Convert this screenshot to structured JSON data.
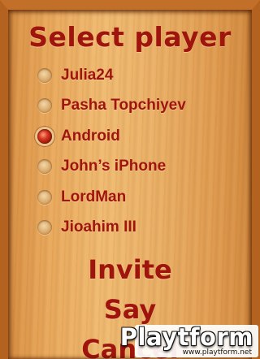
{
  "title": "Select player",
  "players": [
    {
      "name": "Julia24",
      "selected": false
    },
    {
      "name": "Pasha Topchiyev",
      "selected": false
    },
    {
      "name": "Android",
      "selected": true
    },
    {
      "name": "John’s iPhone",
      "selected": false
    },
    {
      "name": "LordMan",
      "selected": false
    },
    {
      "name": "Jioahim III",
      "selected": false
    }
  ],
  "actions": {
    "invite": "Invite",
    "say": "Say",
    "cancel": "Cancel"
  },
  "watermark": {
    "logo": "Playtform",
    "url": "www.playtform.net"
  },
  "colors": {
    "text": "#a0140e",
    "wood": "#e8a85b",
    "frame": "#b3621f"
  }
}
